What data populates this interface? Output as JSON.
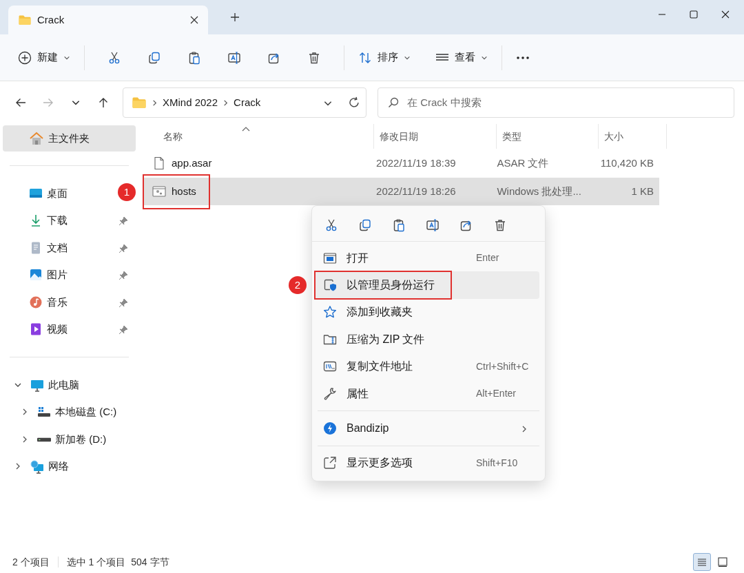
{
  "window": {
    "tab_title": "Crack"
  },
  "toolbar": {
    "new_label": "新建",
    "sort_label": "排序",
    "view_label": "查看"
  },
  "navigation": {
    "back": {
      "disabled": false
    },
    "forward": {
      "disabled": true
    },
    "up": {
      "disabled": false
    }
  },
  "address_bar": {
    "path": [
      "XMind 2022",
      "Crack"
    ]
  },
  "search": {
    "placeholder": "在 Crack 中搜索"
  },
  "sidebar": {
    "home": {
      "label": "主文件夹",
      "selected": true
    },
    "quick_access": [
      {
        "kind": "desktop",
        "label": "桌面",
        "pinned": false,
        "selected": false
      },
      {
        "kind": "downloads",
        "label": "下载",
        "pinned": true,
        "selected": false
      },
      {
        "kind": "documents",
        "label": "文档",
        "pinned": true,
        "selected": false
      },
      {
        "kind": "pictures",
        "label": "图片",
        "pinned": true,
        "selected": false
      },
      {
        "kind": "music",
        "label": "音乐",
        "pinned": true,
        "selected": false
      },
      {
        "kind": "videos",
        "label": "视频",
        "pinned": true,
        "selected": false
      }
    ],
    "tree": [
      {
        "kind": "pc",
        "label": "此电脑",
        "expanded": true,
        "selected": false,
        "children": [
          {
            "kind": "system-drive",
            "label": "本地磁盘 (C:)",
            "expanded": false,
            "selected": false
          },
          {
            "kind": "drive",
            "label": "新加卷 (D:)",
            "expanded": false,
            "selected": false
          }
        ]
      },
      {
        "kind": "network",
        "label": "网络",
        "expanded": false,
        "selected": false
      }
    ]
  },
  "file_list": {
    "columns": [
      {
        "label": "名称",
        "sorted": true
      },
      {
        "label": "修改日期",
        "sorted": false
      },
      {
        "label": "类型",
        "sorted": false
      },
      {
        "label": "大小",
        "sorted": false
      }
    ],
    "rows": [
      {
        "kind": "file",
        "name": "app.asar",
        "modified": "2022/11/19 18:39",
        "type": "ASAR 文件",
        "size": "110,420 KB",
        "selected": false
      },
      {
        "kind": "script",
        "name": "hosts",
        "modified": "2022/11/19 18:26",
        "type": "Windows 批处理...",
        "size": "1 KB",
        "selected": true,
        "annotation": "1"
      }
    ]
  },
  "context_menu": {
    "items": [
      {
        "kind": "open",
        "label": "打开",
        "shortcut": "Enter",
        "highlighted": false,
        "submenu": false,
        "separator_before": false
      },
      {
        "kind": "admin",
        "label": "以管理员身份运行",
        "highlighted": true,
        "submenu": false,
        "separator_before": false,
        "annotation": "2"
      },
      {
        "kind": "favorite",
        "label": "添加到收藏夹",
        "highlighted": false,
        "submenu": false,
        "separator_before": false
      },
      {
        "kind": "zip",
        "label": "压缩为 ZIP 文件",
        "highlighted": false,
        "submenu": false,
        "separator_before": false
      },
      {
        "kind": "path",
        "label": "复制文件地址",
        "shortcut": "Ctrl+Shift+C",
        "highlighted": false,
        "submenu": false,
        "separator_before": false
      },
      {
        "kind": "properties",
        "label": "属性",
        "shortcut": "Alt+Enter",
        "highlighted": false,
        "submenu": false,
        "separator_before": false
      },
      {
        "kind": "bandizip",
        "label": "Bandizip",
        "highlighted": false,
        "submenu": true,
        "separator_before": true
      },
      {
        "kind": "more",
        "label": "显示更多选项",
        "shortcut": "Shift+F10",
        "highlighted": false,
        "submenu": false,
        "separator_before": true
      }
    ]
  },
  "status_bar": {
    "item_count": "2 个项目",
    "selection": "选中 1 个项目",
    "size": "504 字节",
    "views": [
      {
        "kind": "details",
        "selected": true
      },
      {
        "kind": "tiles",
        "selected": false
      }
    ]
  }
}
